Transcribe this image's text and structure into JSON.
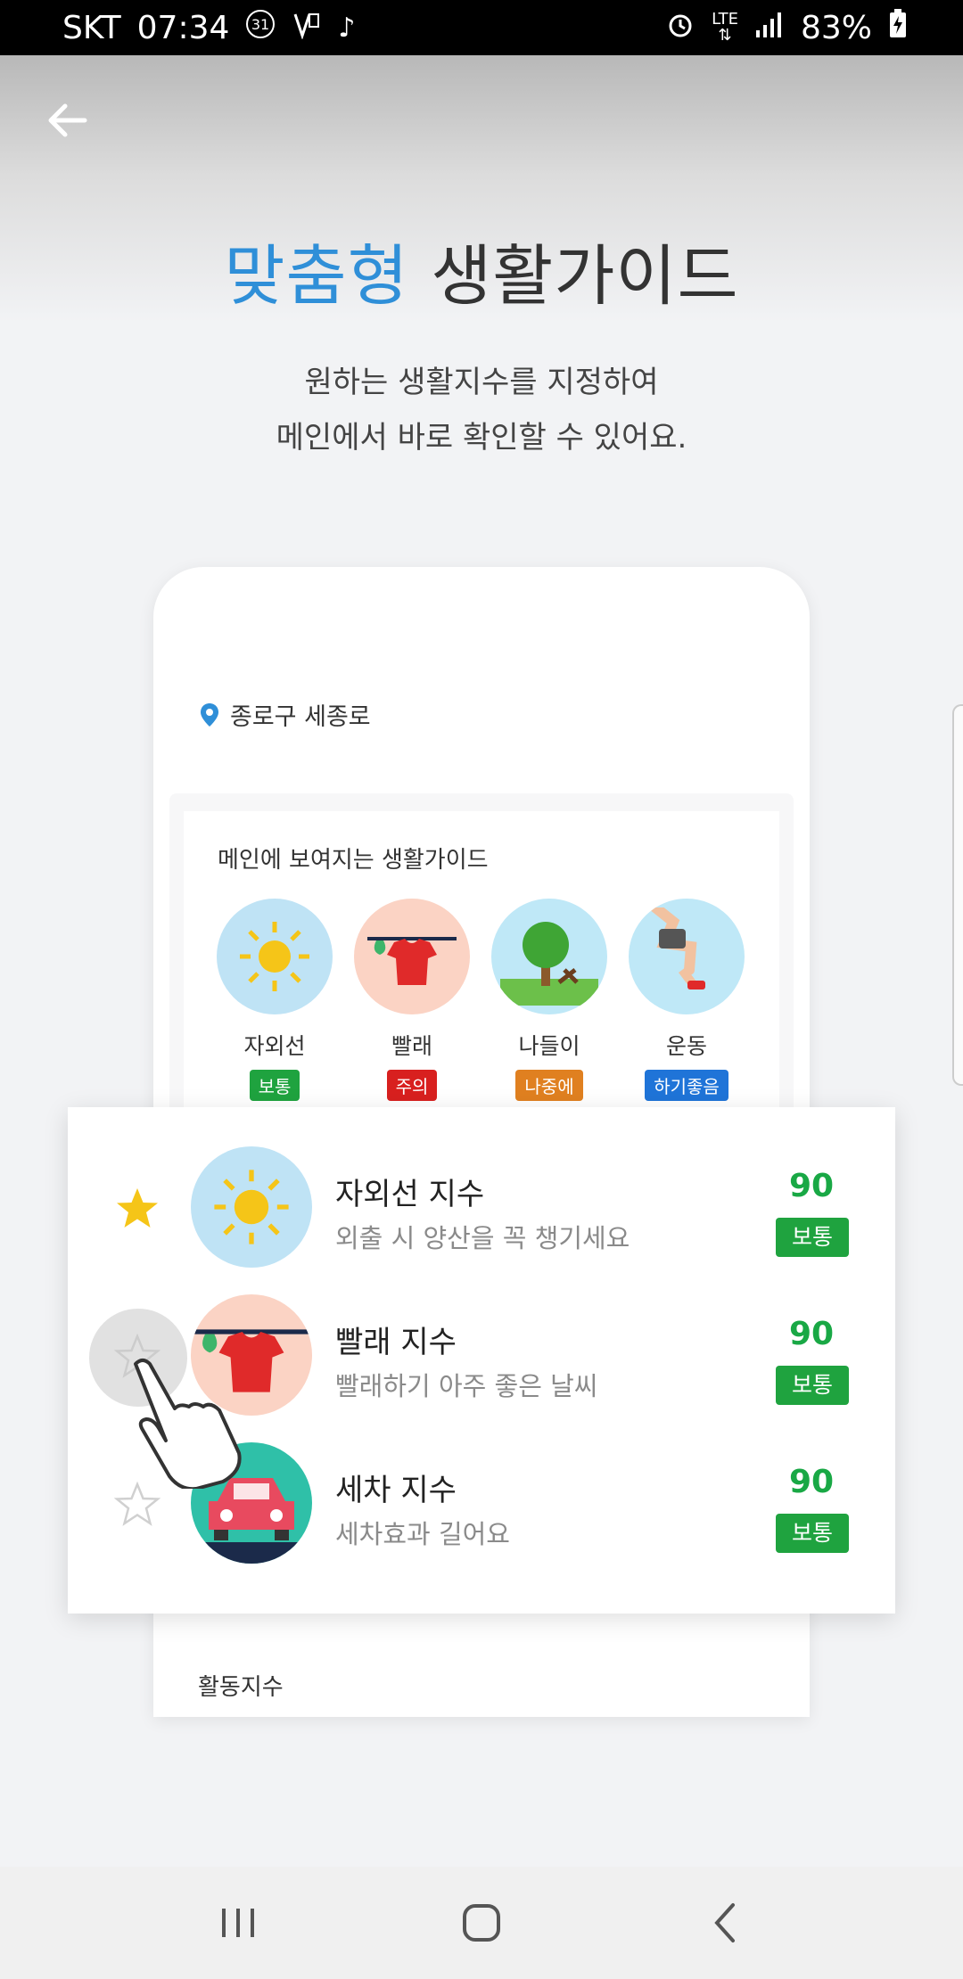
{
  "status_bar": {
    "carrier": "SKT",
    "time": "07:34",
    "calendar_day": "31",
    "network": "LTE",
    "battery": "83%"
  },
  "header": {
    "headline_accent": "맞춤형",
    "headline_rest": "생활가이드",
    "subtitle_line1": "원하는 생활지수를 지정하여",
    "subtitle_line2": "메인에서 바로 확인할 수 있어요."
  },
  "mockup": {
    "location": "종로구 세종로",
    "guide_title": "메인에 보여지는 생활가이드",
    "guide_items": [
      {
        "label": "자외선",
        "badge": "보통",
        "badge_color": "#1fa33f",
        "icon": "sun-icon",
        "bg": "#bfe3f5"
      },
      {
        "label": "빨래",
        "badge": "주의",
        "badge_color": "#d8201f",
        "icon": "laundry-icon",
        "bg": "#fbd3c4"
      },
      {
        "label": "나들이",
        "badge": "나중에",
        "badge_color": "#e08020",
        "icon": "tree-icon",
        "bg": "#bfe8f7"
      },
      {
        "label": "운동",
        "badge": "하기좋음",
        "badge_color": "#1f74d8",
        "icon": "running-icon",
        "bg": "#bfe8f7"
      }
    ],
    "activity_label": "활동지수"
  },
  "index_list": [
    {
      "title": "자외선 지수",
      "desc": "외출 시 양산을 꼭 챙기세요",
      "score": "90",
      "badge": "보통",
      "starred": true,
      "icon": "sun-icon"
    },
    {
      "title": "빨래 지수",
      "desc": "빨래하기 아주 좋은 날씨",
      "score": "90",
      "badge": "보통",
      "starred": false,
      "icon": "laundry-icon"
    },
    {
      "title": "세차 지수",
      "desc": "세차효과 길어요",
      "score": "90",
      "badge": "보통",
      "starred": false,
      "icon": "car-icon"
    }
  ],
  "colors": {
    "accent_blue": "#2f8fd8",
    "good_green": "#1fa33f",
    "star_yellow": "#f5c518"
  }
}
